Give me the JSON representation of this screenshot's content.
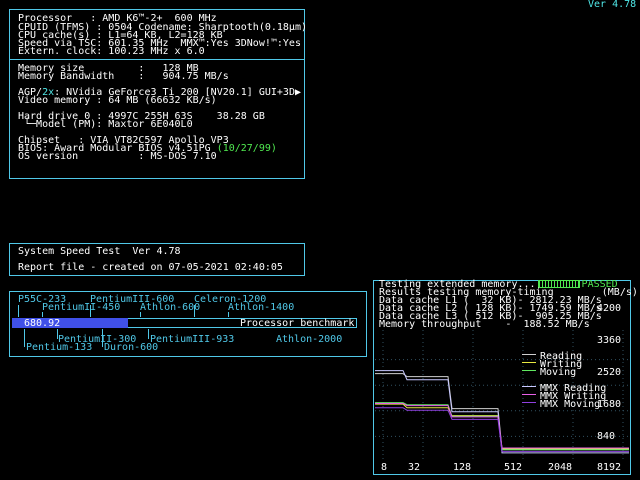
{
  "version": "Ver 4.78",
  "sysinfo": {
    "processor": "Processor   : AMD K6™-2+  600 MHz",
    "cpuid": "CPUID (TFMS) : 0504 Codename: Sharptooth(0.18µm)",
    "cache": "CPU cache(s) : L1=64 KB, L2=128 KB",
    "tsc": "Speed via TSC: 601.35 MHz  MMX™:Yes 3DNow!™:Yes",
    "clock": "Extern. clock: 100.23 MHz x 6.0",
    "mem_size": "Memory size         :   128 MB",
    "mem_bw": "Memory Bandwidth    :   904.75 MB/s",
    "agp_prefix": "AGP/",
    "agp_2x": "2x",
    "agp_rest": ": NVidia GeForce3 Ti 200 [NV20.1] GUI+3D",
    "video_mem": "Video memory : 64 MB (66632 KB/s)",
    "hdd": "Hard drive 0 : 4997C 255H 63S    38.28 GB",
    "hdd_model": " └─Model (PM): Maxtor 6E040L0",
    "chipset": "Chipset   : VIA VT82C597 Apollo VP3",
    "bios_prefix": "BIOS: Award Modular BIOS v4.51PG ",
    "bios_date": "(10/27/99)",
    "os": "OS version          : MS-DOS 7.10"
  },
  "speed_test": {
    "title": "System Speed Test  Ver 4.78",
    "report": "Report file - created on 07-05-2021 02:40:05"
  },
  "benchmark": {
    "score": "680.92",
    "label": "Processor benchmark",
    "score_fraction": 0.12,
    "top_row1": [
      "P55C-233",
      "PentiumIII-600",
      "Celeron-1200"
    ],
    "top_row2": [
      "PentiumII-450",
      "Athlon-600",
      "Athlon-1400"
    ],
    "bot_row1": [
      "PentiumII-300",
      "PentiumIII-933",
      "Athlon-2000"
    ],
    "bot_row2": [
      "Pentium-133",
      "Duron-600"
    ]
  },
  "memtest": {
    "line1": "Testing extended memory...",
    "passed": "PASSED",
    "line2": "Results testing memory-timing        (MB/s)",
    "l1": "Data cache L1 (  32 KB)- 2812.23 MB/s",
    "l2": "Data cache L2 ( 128 KB)- 1749.59 MB/s",
    "l3": "Data cache L3 ( 512 KB)-  905.25 MB/s",
    "throughput": "Memory throughput    -  188.52 MB/s",
    "y_ticks": [
      "4200",
      "3360",
      "2520",
      "1680",
      "840"
    ],
    "x_ticks": [
      "8",
      "32",
      "128",
      "512",
      "2048",
      "8192"
    ],
    "legend": [
      {
        "name": "Reading",
        "color": "#d0d0d0"
      },
      {
        "name": "Writing",
        "color": "#e8e840"
      },
      {
        "name": "Moving",
        "color": "#60e860"
      },
      {
        "name": "MMX Reading",
        "color": "#c8c8ff"
      },
      {
        "name": "MMX Writing",
        "color": "#e860e8"
      },
      {
        "name": "MMX Moving",
        "color": "#9040e0"
      }
    ]
  },
  "chart_data": {
    "type": "line",
    "x": [
      "8",
      "32",
      "128",
      "512",
      "2048",
      "8192"
    ],
    "ylim": [
      0,
      4200
    ],
    "series": [
      {
        "name": "Reading",
        "values": [
          2900,
          2800,
          1750,
          420,
          420,
          420
        ]
      },
      {
        "name": "Writing",
        "values": [
          1900,
          1780,
          1520,
          430,
          430,
          430
        ]
      },
      {
        "name": "Moving",
        "values": [
          1950,
          1880,
          1500,
          400,
          400,
          400
        ]
      },
      {
        "name": "MMX Reading",
        "values": [
          3000,
          2700,
          1650,
          300,
          300,
          300
        ]
      },
      {
        "name": "MMX Writing",
        "values": [
          1920,
          1850,
          1480,
          460,
          460,
          460
        ]
      },
      {
        "name": "MMX Moving",
        "values": [
          1780,
          1700,
          1400,
          350,
          350,
          350
        ]
      }
    ]
  }
}
